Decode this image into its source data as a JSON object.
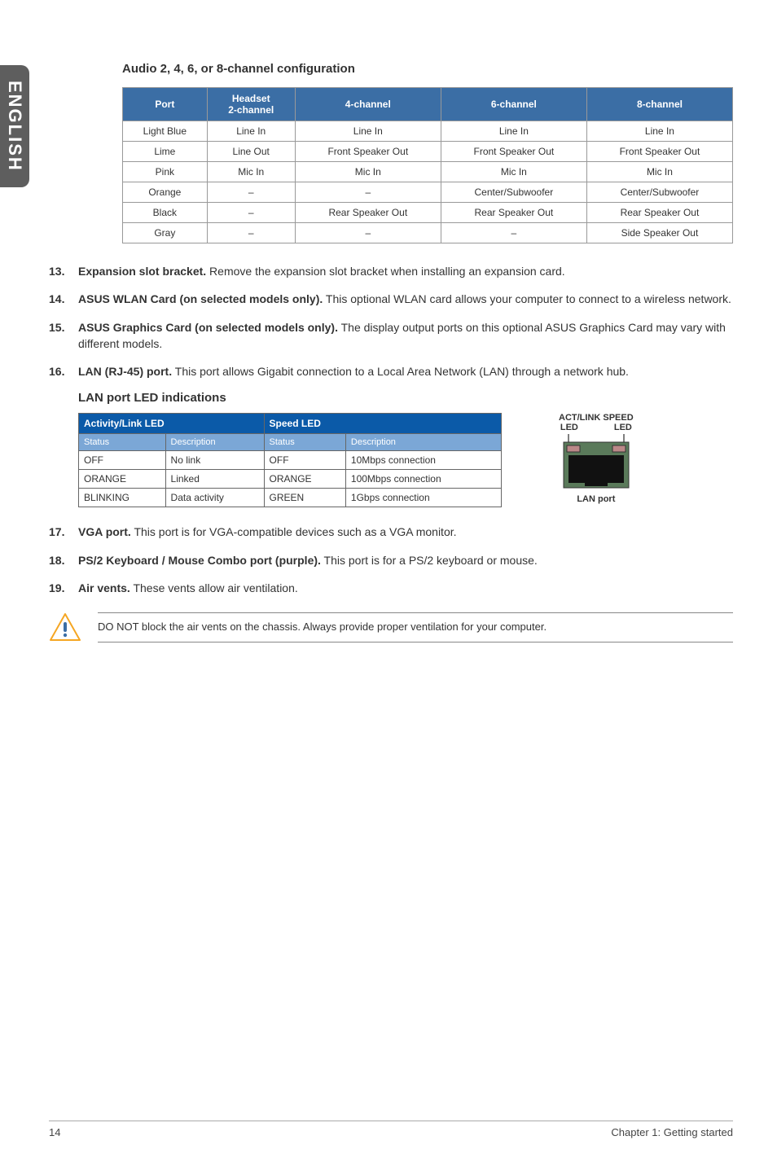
{
  "sideTab": "ENGLISH",
  "audioHeading": "Audio 2, 4, 6, or 8-channel configuration",
  "audioTable": {
    "headers": [
      "Port",
      "Headset\n2-channel",
      "4-channel",
      "6-channel",
      "8-channel"
    ],
    "rows": [
      [
        "Light Blue",
        "Line In",
        "Line In",
        "Line In",
        "Line In"
      ],
      [
        "Lime",
        "Line Out",
        "Front Speaker Out",
        "Front Speaker Out",
        "Front Speaker Out"
      ],
      [
        "Pink",
        "Mic In",
        "Mic In",
        "Mic In",
        "Mic In"
      ],
      [
        "Orange",
        "–",
        "–",
        "Center/Subwoofer",
        "Center/Subwoofer"
      ],
      [
        "Black",
        "–",
        "Rear Speaker Out",
        "Rear Speaker Out",
        "Rear Speaker Out"
      ],
      [
        "Gray",
        "–",
        "–",
        "–",
        "Side Speaker Out"
      ]
    ]
  },
  "items1": [
    {
      "num": "13.",
      "bold": "Expansion slot bracket.",
      "text": " Remove the expansion slot bracket when installing an expansion card."
    },
    {
      "num": "14.",
      "bold": "ASUS WLAN Card (on selected models only).",
      "text": " This optional WLAN card allows your computer to connect to a wireless network."
    },
    {
      "num": "15.",
      "bold": "ASUS Graphics Card (on selected models only).",
      "text": " The display output ports on this optional ASUS Graphics Card may vary with different models."
    },
    {
      "num": "16.",
      "bold": "LAN (RJ-45) port.",
      "text": " This port allows Gigabit connection to a Local Area Network (LAN) through a network hub."
    }
  ],
  "lanHeading": "LAN port LED indications",
  "lanTable": {
    "topHeaders": [
      "Activity/Link LED",
      "Speed LED"
    ],
    "subHeaders": [
      "Status",
      "Description",
      "Status",
      "Description"
    ],
    "rows": [
      [
        "OFF",
        "No link",
        "OFF",
        "10Mbps connection"
      ],
      [
        "ORANGE",
        "Linked",
        "ORANGE",
        "100Mbps connection"
      ],
      [
        "BLINKING",
        "Data activity",
        "GREEN",
        "1Gbps connection"
      ]
    ]
  },
  "lanDiagram": {
    "topLabel": "ACT/LINK SPEED",
    "leftLed": "LED",
    "rightLed": "LED",
    "bottom": "LAN port"
  },
  "items2": [
    {
      "num": "17.",
      "bold": "VGA port.",
      "text": " This port is for VGA-compatible devices such as a VGA monitor."
    },
    {
      "num": "18.",
      "bold": "PS/2 Keyboard / Mouse Combo port (purple).",
      "text": " This port is for a PS/2 keyboard or mouse."
    },
    {
      "num": "19.",
      "bold": "Air vents.",
      "text": " These vents allow air ventilation."
    }
  ],
  "callout": "DO NOT block the air vents on the chassis. Always provide proper ventilation for your computer.",
  "footer": {
    "page": "14",
    "chapter": "Chapter 1: Getting started"
  }
}
